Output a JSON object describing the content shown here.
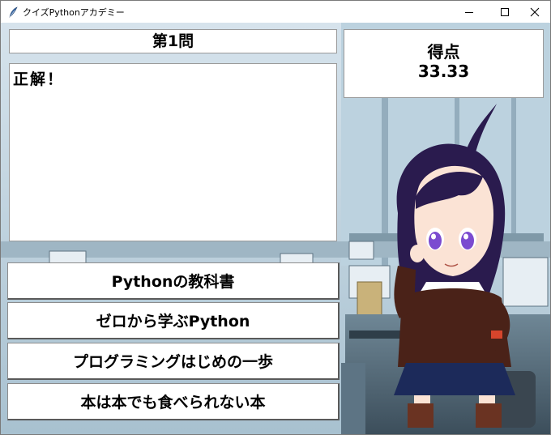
{
  "window": {
    "title": "クイズPythonアカデミー",
    "icon": "feather-icon",
    "controls": [
      "minimize-icon",
      "maximize-icon",
      "close-icon"
    ]
  },
  "question": {
    "title": "第1問"
  },
  "result": {
    "text": "正解！"
  },
  "score": {
    "label": "得点",
    "value": "33.33"
  },
  "answers": [
    {
      "label": "Pythonの教科書"
    },
    {
      "label": "ゼロから学ぶPython"
    },
    {
      "label": "プログラミングはじめの一歩"
    },
    {
      "label": "本は本でも食べられない本"
    }
  ],
  "colors": {
    "hair": "#2a1b4e",
    "hoodie": "#4a2218",
    "skirt": "#1c2a5a",
    "eyes": "#7b4bd0"
  }
}
